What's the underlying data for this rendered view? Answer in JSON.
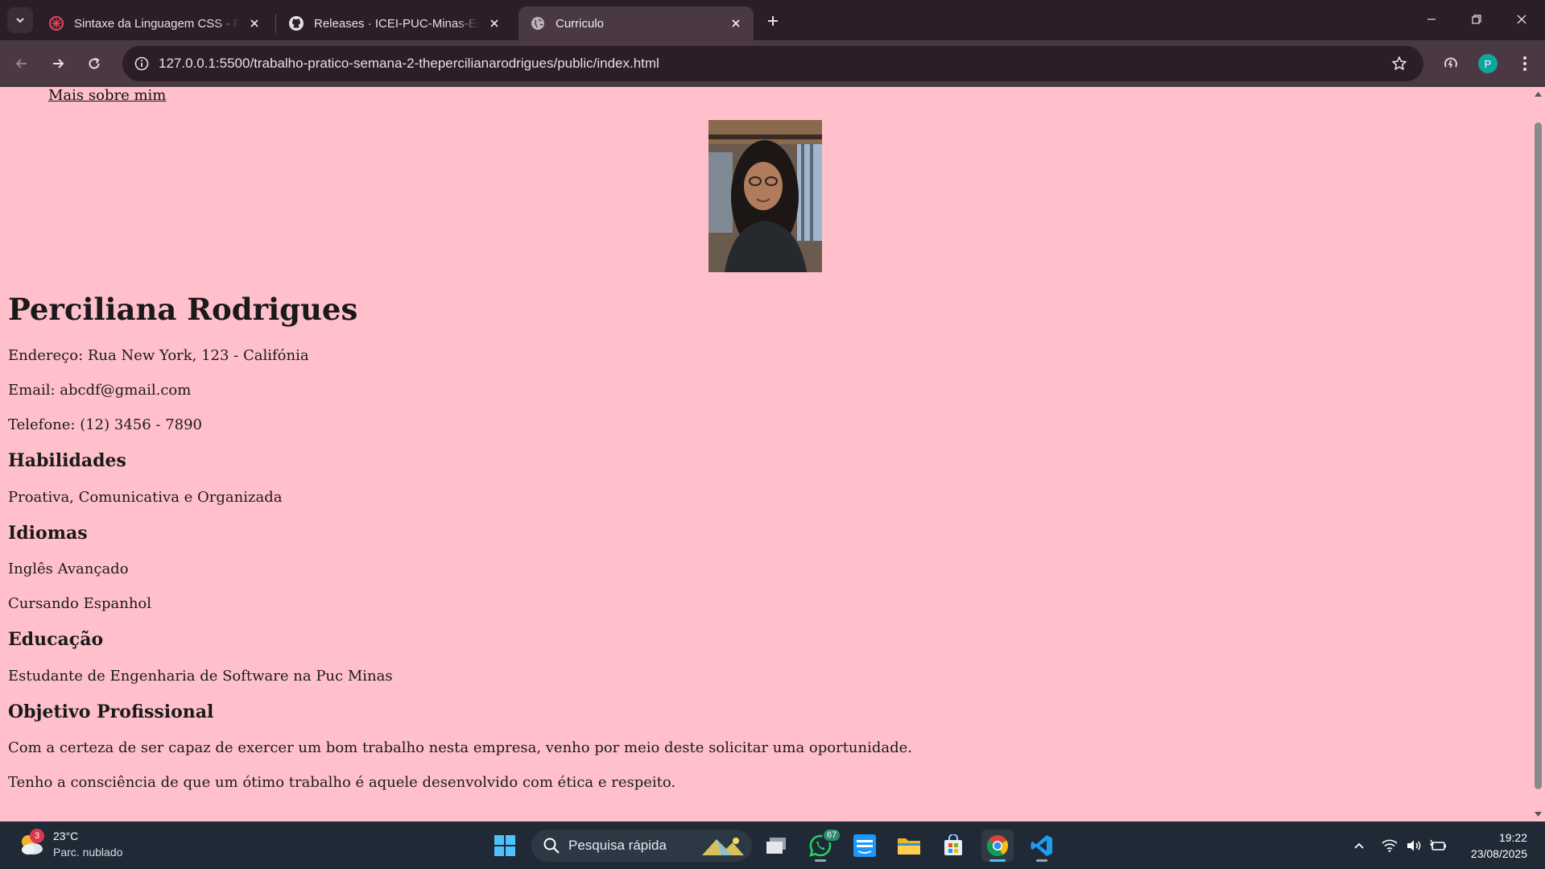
{
  "browser": {
    "tabs": [
      {
        "title": "Sintaxe da Linguagem CSS - Re",
        "icon": "react-icon",
        "active": false
      },
      {
        "title": "Releases · ICEI-PUC-Minas-EngS",
        "icon": "github-icon",
        "active": false
      },
      {
        "title": "Curriculo",
        "icon": "globe-icon",
        "active": true
      }
    ],
    "url": "127.0.0.1:5500/trabalho-pratico-semana-2-thepercilianarodrigues/public/index.html",
    "profile_initial": "P",
    "accent": "#12a4a0"
  },
  "page": {
    "background": "#ffc0cb",
    "link": "Mais sobre mim",
    "photo_alt": "Foto de perfil",
    "name": "Perciliana Rodrigues",
    "address": "Endereço: Rua New York, 123 - Califónia",
    "email": "Email: abcdf@gmail.com",
    "phone": "Telefone: (12) 3456 - 7890",
    "skills_heading": "Habilidades",
    "skills": "Proativa, Comunicativa e Organizada",
    "languages_heading": "Idiomas",
    "languages": [
      "Inglês Avançado",
      "Cursando Espanhol"
    ],
    "education_heading": "Educação",
    "education": "Estudante de Engenharia de Software na Puc Minas",
    "objective_heading": "Objetivo Profissional",
    "objective": [
      "Com a certeza de ser capaz de exercer um bom trabalho nesta empresa, venho por meio deste solicitar uma oportunidade.",
      "Tenho a consciência de que um ótimo trabalho é aquele desenvolvido com ética e respeito."
    ]
  },
  "taskbar": {
    "weather_temp": "23°C",
    "weather_desc": "Parc. nublado",
    "weather_badge": "3",
    "search_placeholder": "Pesquisa rápida",
    "whatsapp_badge": "67",
    "time": "19:22",
    "date": "23/08/2025"
  }
}
